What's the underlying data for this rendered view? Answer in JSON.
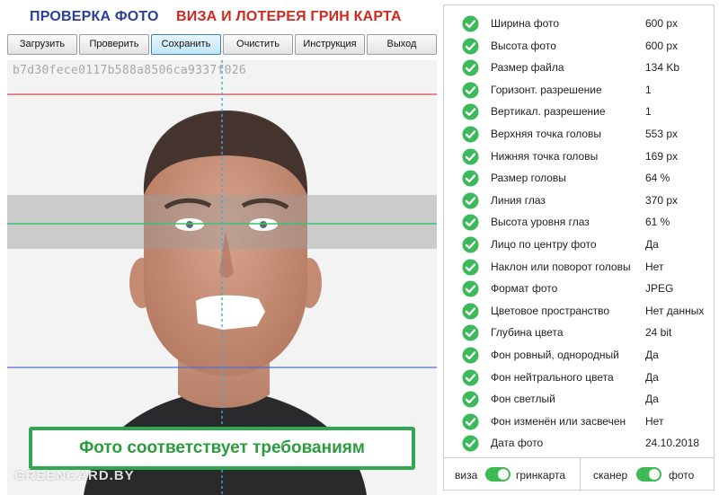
{
  "header": {
    "title_left": "ПРОВЕРКА ФОТО",
    "title_right": "ВИЗА И ЛОТЕРЕЯ ГРИН КАРТА"
  },
  "toolbar": {
    "buttons": [
      {
        "label": "Загрузить"
      },
      {
        "label": "Проверить"
      },
      {
        "label": "Сохранить",
        "active": true
      },
      {
        "label": "Очистить"
      },
      {
        "label": "Инструкция"
      },
      {
        "label": "Выход"
      }
    ]
  },
  "photo": {
    "hash": "b7d30fece0117b588a8506ca9337f026",
    "status_text": "Фото соответствует требованиям",
    "watermark": "GREENCARD.BY",
    "colors": {
      "top_line": "#d84a4a",
      "eye_line": "#39c56a",
      "bottom_line": "#4a6fd8",
      "center_line": "#4aa5d6",
      "eye_band": "#bdbdbd",
      "status_border": "#2fa84f"
    }
  },
  "checks": [
    {
      "label": "Ширина фото",
      "value": "600 px"
    },
    {
      "label": "Высота фото",
      "value": "600 px"
    },
    {
      "label": "Размер файла",
      "value": "134 Kb"
    },
    {
      "label": "Горизонт. разрешение",
      "value": "1"
    },
    {
      "label": "Вертикал. разрешение",
      "value": "1"
    },
    {
      "label": "Верхняя точка головы",
      "value": "553 px"
    },
    {
      "label": "Нижняя точка головы",
      "value": "169 px"
    },
    {
      "label": "Размер головы",
      "value": "64 %"
    },
    {
      "label": "Линия глаз",
      "value": "370 px"
    },
    {
      "label": "Высота уровня глаз",
      "value": "61 %"
    },
    {
      "label": "Лицо по центру фото",
      "value": "Да"
    },
    {
      "label": "Наклон или поворот головы",
      "value": "Нет"
    },
    {
      "label": "Формат фото",
      "value": "JPEG"
    },
    {
      "label": "Цветовое пространство",
      "value": "Нет данных"
    },
    {
      "label": "Глубина цвета",
      "value": "24 bit"
    },
    {
      "label": "Фон ровный, однородный",
      "value": "Да"
    },
    {
      "label": "Фон нейтрального цвета",
      "value": "Да"
    },
    {
      "label": "Фон светлый",
      "value": "Да"
    },
    {
      "label": "Фон изменён или засвечен",
      "value": "Нет"
    },
    {
      "label": "Дата фото",
      "value": "24.10.2018"
    }
  ],
  "check_icon": "check-circle-icon",
  "check_color": "#3cb95a",
  "footer": {
    "toggle1_left": "виза",
    "toggle1_right": "гринкарта",
    "toggle2_left": "сканер",
    "toggle2_right": "фото"
  }
}
